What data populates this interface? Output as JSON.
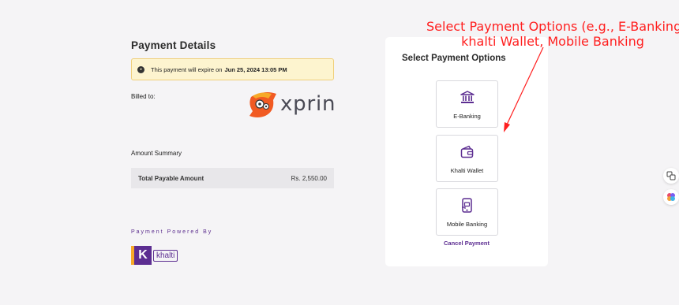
{
  "payment_details": {
    "title": "Payment Details",
    "expire_prefix": "This payment will expire on",
    "expire_time": "Jun 25, 2024 13:05 PM",
    "billed_label": "Billed to:",
    "merchant_name": "xprin"
  },
  "amount_summary": {
    "title": "Amount Summary",
    "total_label": "Total Payable Amount",
    "total_value": "Rs. 2,550.00"
  },
  "powered_by": {
    "label": "Payment Powered By",
    "brand": "khalti",
    "brand_letter": "K"
  },
  "payment_options": {
    "title": "Select Payment Options",
    "items": [
      {
        "label": "E-Banking",
        "icon": "bank-icon"
      },
      {
        "label": "Khalti Wallet",
        "icon": "wallet-icon"
      },
      {
        "label": "Mobile Banking",
        "icon": "mobile-banking-icon"
      }
    ],
    "cancel_label": "Cancel Payment"
  },
  "annotation": {
    "line1": "Select Payment Options (e.g., E-Banking,",
    "line2": "khalti Wallet, Mobile Banking"
  },
  "colors": {
    "brand_purple": "#5c2d91",
    "annotation_red": "#ff1f1f",
    "warning_bg": "#fdf4cf"
  }
}
